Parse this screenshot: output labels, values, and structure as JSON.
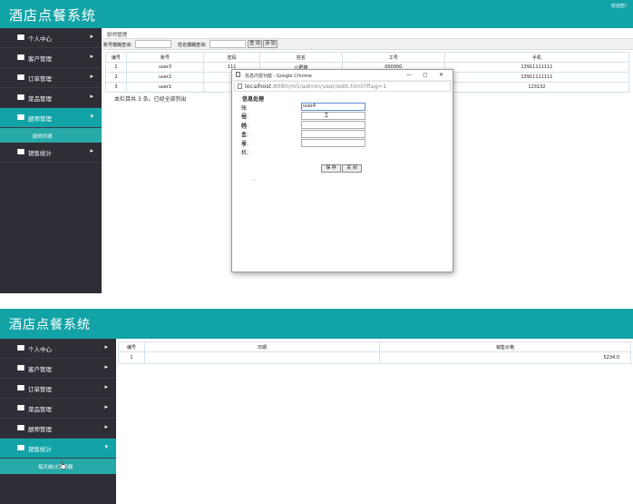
{
  "app": {
    "title": "酒店点餐系统",
    "welcome": "欢迎您！"
  },
  "colors": {
    "header": "#12a3a6",
    "sidebar": "#2f2e36",
    "active": "#13a3a6",
    "submenu": "#26a9a8"
  },
  "screen1": {
    "sidebar": {
      "items": [
        {
          "label": "个人中心",
          "icon": "menu-icon",
          "arrow": "▸"
        },
        {
          "label": "客户管理",
          "icon": "menu-icon",
          "arrow": "▸"
        },
        {
          "label": "订单管理",
          "icon": "menu-icon",
          "arrow": "▸"
        },
        {
          "label": "菜品管理",
          "icon": "menu-icon",
          "arrow": "▸"
        },
        {
          "label": "厨师管理",
          "icon": "menu-icon",
          "arrow": "▾"
        },
        {
          "label": "销售统计",
          "icon": "menu-icon",
          "arrow": "▸"
        }
      ],
      "subitem": "厨师列表"
    },
    "breadcrumb": "厨师管理",
    "search": {
      "account_label": "账号模糊查询:",
      "name_label": "姓名模糊查询:",
      "query_btn": "查 询",
      "add_btn": "添 加"
    },
    "table": {
      "headers": [
        "编号",
        "账号",
        "密码",
        "姓名",
        "工号",
        "手机"
      ],
      "rows": [
        [
          "1",
          "user3",
          "111",
          "小肥猫",
          "000000",
          "13911111111"
        ],
        [
          "2",
          "user2",
          "",
          "",
          "",
          "13911111111"
        ],
        [
          "3",
          "user1",
          "",
          "",
          "",
          "123132"
        ]
      ]
    },
    "footer": "本栏目共 3 条。已经全部列出",
    "popup": {
      "window_title": "信息内容功能 - Google Chrome",
      "min_icon": "—",
      "max_icon": "▢",
      "close_icon": "✕",
      "url_host": "localhost",
      "url_path": ":8080/m5/admin/user/edit.html?flag=1",
      "heading": "信息处理",
      "fields": [
        {
          "label": "账号:",
          "value": "user4"
        },
        {
          "label": "密码:",
          "value": ""
        },
        {
          "label": "姓名:",
          "value": ""
        },
        {
          "label": "工号:",
          "value": ""
        },
        {
          "label": "手机:",
          "value": ""
        }
      ],
      "save_btn": "保 存",
      "close_btn": "关 闭"
    }
  },
  "screen2": {
    "sidebar": {
      "items": [
        {
          "label": "个人中心",
          "arrow": "▸"
        },
        {
          "label": "客户管理",
          "arrow": "▸"
        },
        {
          "label": "订单管理",
          "arrow": "▸"
        },
        {
          "label": "菜品管理",
          "arrow": "▸"
        },
        {
          "label": "厨师管理",
          "arrow": "▸"
        },
        {
          "label": "销售统计",
          "arrow": "▾"
        }
      ],
      "subitem": "每天统计消费额"
    },
    "table": {
      "headers": [
        "编号",
        "日期",
        "销售价格"
      ],
      "rows": [
        [
          "1",
          "",
          "5234.0"
        ]
      ]
    }
  }
}
